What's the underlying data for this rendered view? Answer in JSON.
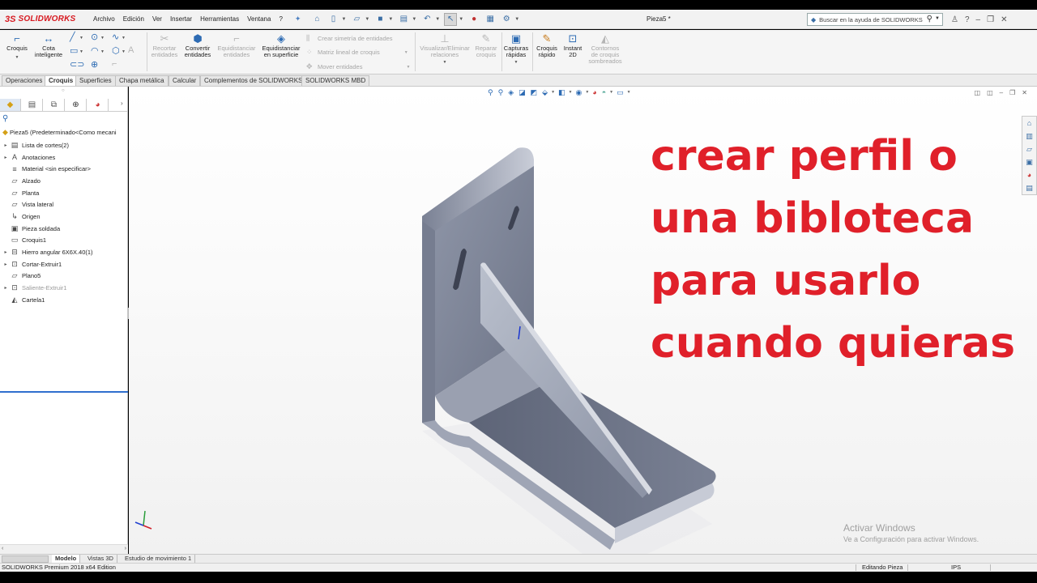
{
  "app": {
    "logo_mark": "3S",
    "logo_text": "SOLIDWORKS",
    "document_title": "Pieza5 *"
  },
  "menu": [
    "Archivo",
    "Edición",
    "Ver",
    "Insertar",
    "Herramientas",
    "Ventana",
    "?"
  ],
  "help_search": {
    "placeholder": "Buscar en la ayuda de SOLIDWORKS"
  },
  "command_manager": {
    "croquis": "Croquis",
    "cota_l1": "Cota",
    "cota_l2": "inteligente",
    "recortar_l1": "Recortar",
    "recortar_l2": "entidades",
    "convertir_l1": "Convertir",
    "convertir_l2": "entidades",
    "equid_l1": "Equidistanciar",
    "equid_l2": "entidades",
    "equid_sup_l1": "Equidistanciar",
    "equid_sup_l2": "en superficie",
    "simetria": "Crear simetría de entidades",
    "matriz": "Matriz lineal de croquis",
    "mover": "Mover entidades",
    "visualizar_l1": "Visualizar/Eliminar",
    "visualizar_l2": "relaciones",
    "reparar_l1": "Reparar",
    "reparar_l2": "croquis",
    "capturas_l1": "Capturas",
    "capturas_l2": "rápidas",
    "croquis_rapido_l1": "Croquis",
    "croquis_rapido_l2": "rápido",
    "instant_l1": "Instant",
    "instant_l2": "2D",
    "contornos_l1": "Contornos",
    "contornos_l2": "de croquis",
    "contornos_l3": "sombreados"
  },
  "tabs": [
    "Operaciones",
    "Croquis",
    "Superficies",
    "Chapa metálica",
    "Calcular",
    "Complementos de SOLIDWORKS",
    "SOLIDWORKS MBD"
  ],
  "tree": {
    "root": "Pieza5  (Predeterminado<Como mecani",
    "items": [
      {
        "label": "Lista de cortes(2)",
        "expand": "▸",
        "icon": "cut-list-icon"
      },
      {
        "label": "Anotaciones",
        "expand": "▸",
        "icon": "annotations-icon"
      },
      {
        "label": "Material <sin especificar>",
        "expand": "",
        "icon": "material-icon"
      },
      {
        "label": "Alzado",
        "expand": "",
        "icon": "plane-icon"
      },
      {
        "label": "Planta",
        "expand": "",
        "icon": "plane-icon"
      },
      {
        "label": "Vista lateral",
        "expand": "",
        "icon": "plane-icon"
      },
      {
        "label": "Origen",
        "expand": "",
        "icon": "origin-icon"
      },
      {
        "label": "Pieza soldada",
        "expand": "",
        "icon": "weldment-icon"
      },
      {
        "label": "Croquis1",
        "expand": "",
        "icon": "sketch-icon"
      },
      {
        "label": "Hierro angular 6X6X.40(1)",
        "expand": "▸",
        "icon": "structural-member-icon"
      },
      {
        "label": "Cortar-Extruir1",
        "expand": "▸",
        "icon": "cut-extrude-icon"
      },
      {
        "label": "Plano5",
        "expand": "",
        "icon": "plane-icon"
      },
      {
        "label": "Saliente-Extruir1",
        "expand": "▸",
        "icon": "boss-extrude-icon"
      },
      {
        "label": "Cartela1",
        "expand": "",
        "icon": "gusset-icon"
      }
    ]
  },
  "overlay_text": "crear perfil o\nuna bibloteca\npara usarlo\ncuando quieras",
  "watermark": {
    "line1": "Activar Windows",
    "line2": "Ve a Configuración para activar Windows."
  },
  "bottom_tabs": [
    "Modelo",
    "Vistas 3D",
    "Estudio de movimiento 1"
  ],
  "status": {
    "edition": "SOLIDWORKS Premium 2018 x64 Edition",
    "mode": "Editando Pieza",
    "units": "IPS"
  },
  "colors": {
    "brand_red": "#d71920",
    "overlay_red": "#e0202a",
    "rollback_blue": "#2f6fce"
  }
}
